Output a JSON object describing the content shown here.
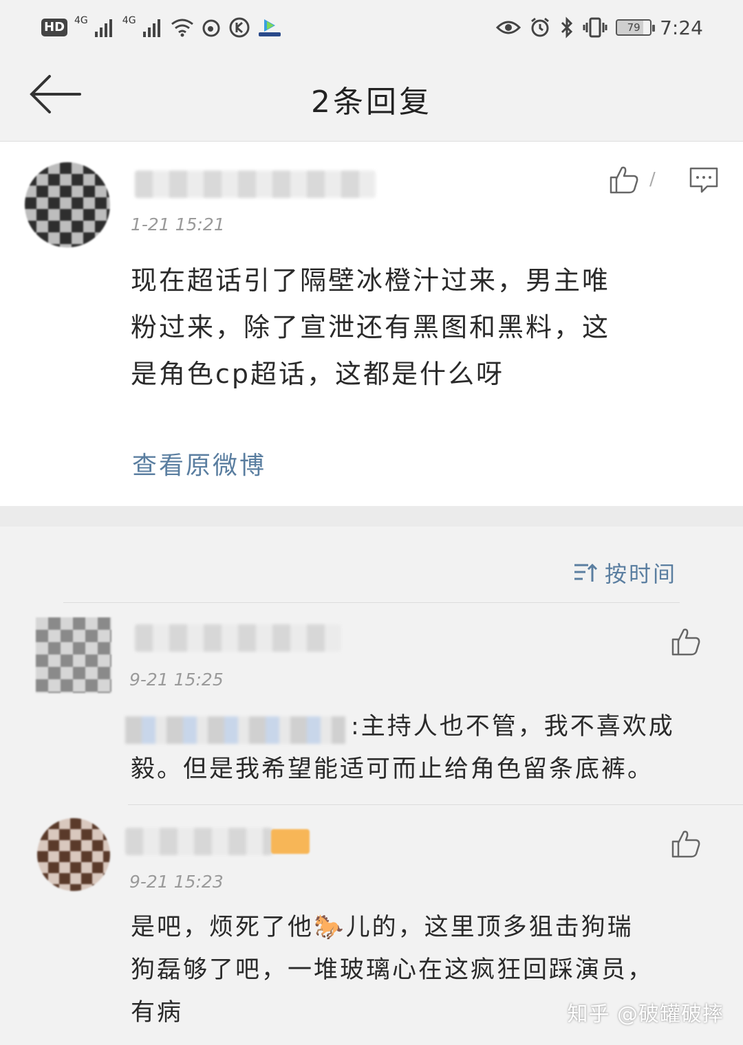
{
  "status_bar": {
    "hd": "HD",
    "sim1_network": "4G",
    "sim2_network": "4G",
    "battery": "79",
    "time": "7:24",
    "icons": [
      "signal-icon",
      "wifi-icon",
      "weibo-icon",
      "kuaishou-icon",
      "app-icon",
      "eye-icon",
      "alarm-icon",
      "bluetooth-icon",
      "vibrate-icon"
    ]
  },
  "header": {
    "title": "2条回复",
    "back_icon": "arrow-left-icon"
  },
  "main_post": {
    "timestamp": "1-21  15:21",
    "like_count": "/",
    "text_lines": [
      "现在超话引了隔壁冰橙汁过来，男主唯",
      "粉过来，除了宣泄还有黑图和黑料，这",
      "是角色cp超话，这都是什么呀"
    ],
    "view_original": "查看原微博"
  },
  "replies": {
    "sort_label": "按时间",
    "items": [
      {
        "timestamp": "9-21  15:25",
        "text_lines": [
          ":主持人也不管，我不喜欢成",
          "毅。但是我希望能适可而止给角色留条底裤。"
        ]
      },
      {
        "timestamp": "9-21  15:23",
        "text_lines": [
          "是吧，烦死了他🐎儿的，这里顶多狙击狗瑞",
          "狗磊够了吧，一堆玻璃心在这疯狂回踩演员，",
          "有病"
        ]
      }
    ]
  },
  "watermark": "知乎 @破罐破摔"
}
